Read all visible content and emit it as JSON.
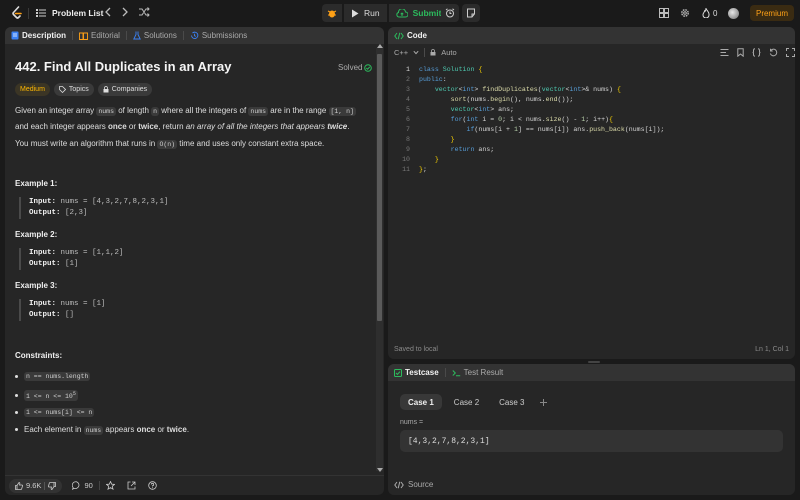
{
  "topbar": {
    "title": "Problem List",
    "run_label": "Run",
    "submit_label": "Submit",
    "streak_count": "0",
    "premium_label": "Premium"
  },
  "left": {
    "tabs": [
      "Description",
      "Editorial",
      "Solutions",
      "Submissions"
    ],
    "title": "442. Find All Duplicates in an Array",
    "status": "Solved",
    "chips": [
      "Medium",
      "Topics",
      "Companies"
    ],
    "para1": {
      "t1": "Given an integer array ",
      "c1": "nums",
      "t2": " of length ",
      "c2": "n",
      "t3": " where all the integers of ",
      "c3": "nums",
      "t4": " are in the range ",
      "c4": "[1, n]",
      "t5": " and each integer appears ",
      "b1": "once",
      "t6": " or ",
      "b2": "twice",
      "t7": ", return ",
      "i1": "an array of all the integers that appears ",
      "i2": "twice",
      "t8": "."
    },
    "para2": {
      "t1": "You must write an algorithm that runs in ",
      "c1": "O(n)",
      "t2": " time and uses only constant extra space."
    },
    "examples": [
      {
        "heading": "Example 1:",
        "input_label": "Input:",
        "input": " nums = [4,3,2,7,8,2,3,1]",
        "output_label": "Output:",
        "output": " [2,3]"
      },
      {
        "heading": "Example 2:",
        "input_label": "Input:",
        "input": " nums = [1,1,2]",
        "output_label": "Output:",
        "output": " [1]"
      },
      {
        "heading": "Example 3:",
        "input_label": "Input:",
        "input": " nums = [1]",
        "output_label": "Output:",
        "output": " []"
      }
    ],
    "constraints_heading": "Constraints:",
    "constraints": {
      "c1": "n == nums.length",
      "c2a": "1 <= n <= 10",
      "c2sup": "5",
      "c3": "1 <= nums[i] <= n",
      "c4_t1": "Each element in ",
      "c4_code": "nums",
      "c4_t2": " appears ",
      "c4_b1": "once",
      "c4_t3": " or ",
      "c4_b2": "twice",
      "c4_t4": "."
    },
    "footer": {
      "likes": "9.6K",
      "comments": "90"
    }
  },
  "code": {
    "header": "Code",
    "language": "C++",
    "mode": "Auto",
    "saved": "Saved to local",
    "cursor": "Ln 1, Col 1",
    "line_numbers": [
      "1",
      "2",
      "3",
      "4",
      "5",
      "6",
      "7",
      "8",
      "9",
      "10",
      "11"
    ]
  },
  "test": {
    "tabs": [
      "Testcase",
      "Test Result"
    ],
    "cases": [
      "Case 1",
      "Case 2",
      "Case 3"
    ],
    "var_label": "nums =",
    "var_value": "[4,3,2,7,8,2,3,1]",
    "source_label": "Source"
  },
  "colors": {
    "accent": "#ffa116",
    "success": "#2cbb5d",
    "medium": "#ffb800"
  }
}
